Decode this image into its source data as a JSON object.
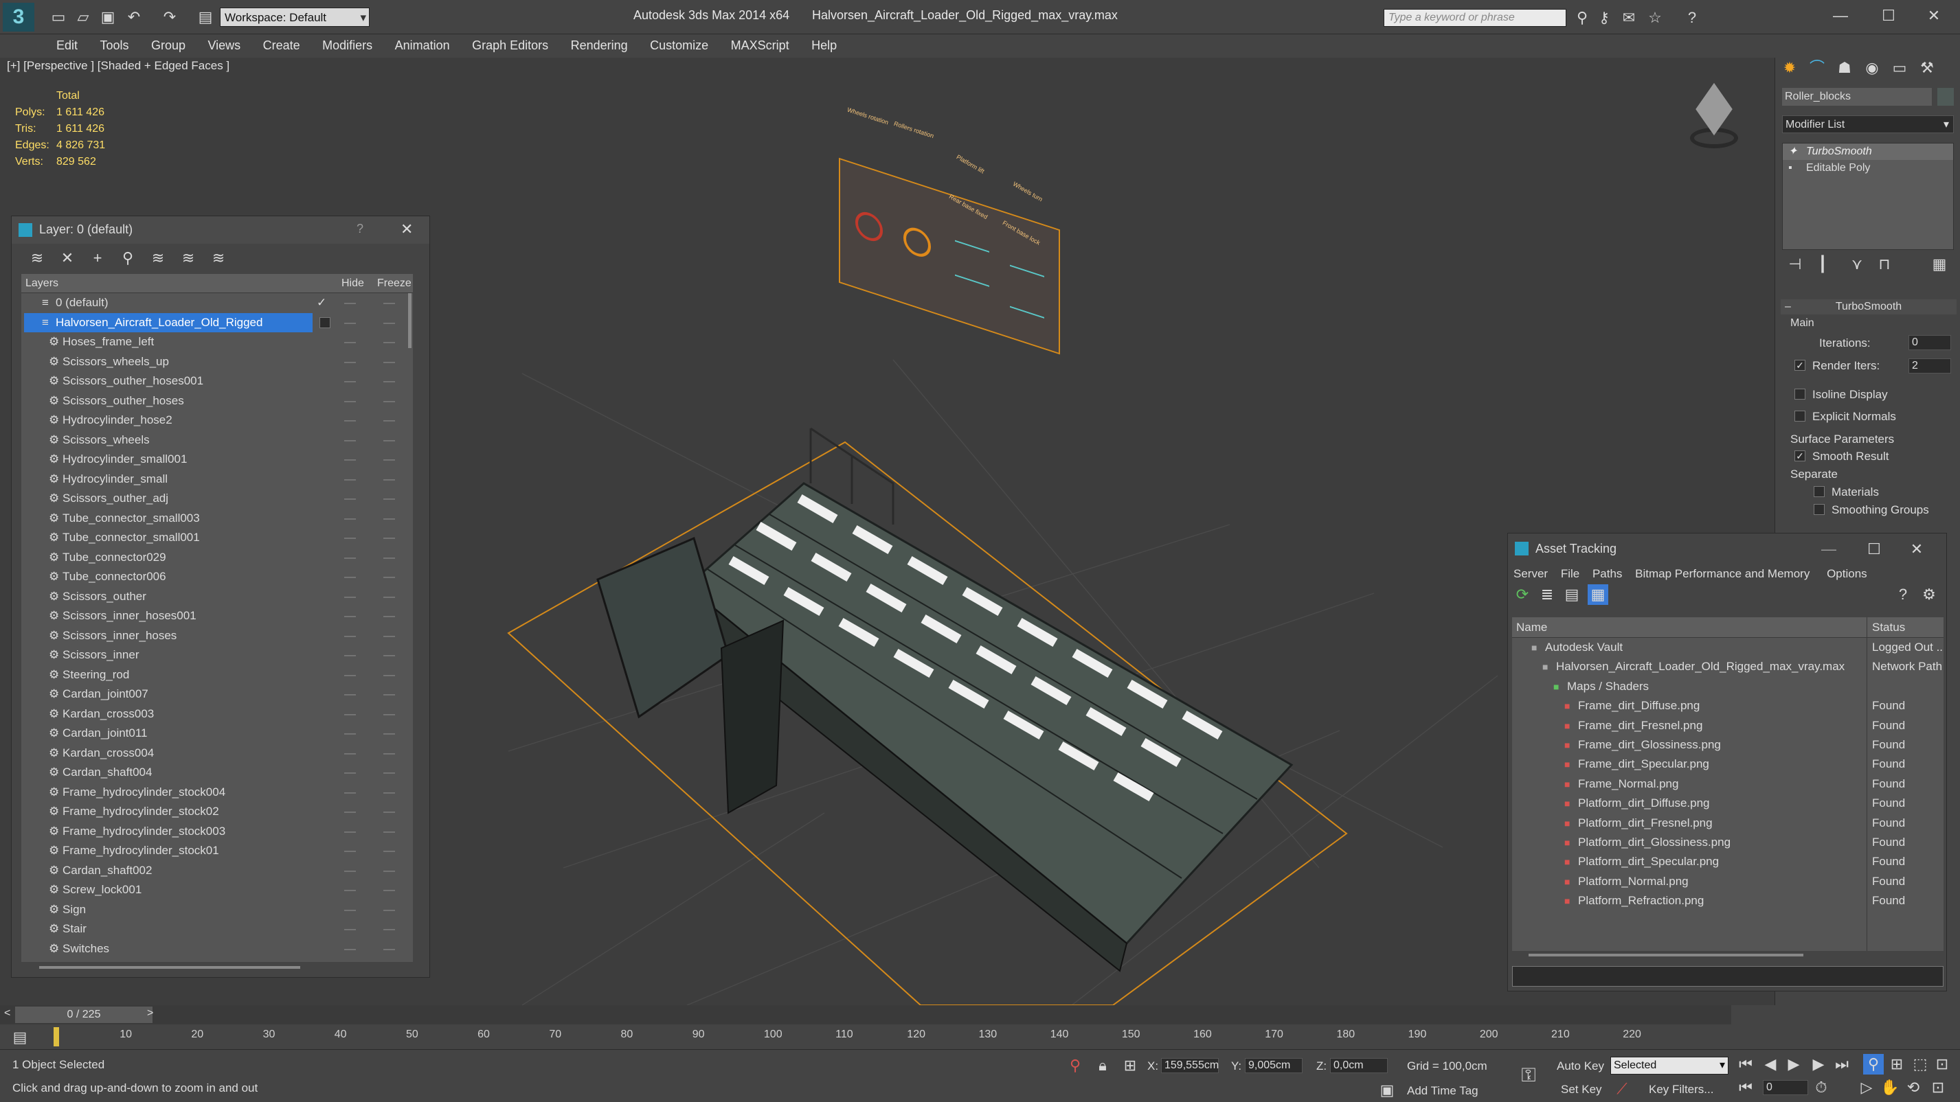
{
  "app": {
    "workspace": "Workspace: Default",
    "title": "Autodesk 3ds Max  2014 x64",
    "filename": "Halvorsen_Aircraft_Loader_Old_Rigged_max_vray.max",
    "search_placeholder": "Type a keyword or phrase"
  },
  "menu": [
    "Edit",
    "Tools",
    "Group",
    "Views",
    "Create",
    "Modifiers",
    "Animation",
    "Graph Editors",
    "Rendering",
    "Customize",
    "MAXScript",
    "Help"
  ],
  "viewport": {
    "label": "[+] [Perspective ] [Shaded + Edged Faces ]",
    "stats_header": "Total",
    "stats": [
      {
        "k": "Polys:",
        "v": "1 611 426"
      },
      {
        "k": "Tris:",
        "v": "1 611 426"
      },
      {
        "k": "Edges:",
        "v": "4 826 731"
      },
      {
        "k": "Verts:",
        "v": "829 562"
      }
    ],
    "panel_labels": [
      "Wheels rotation",
      "Rollers rotation",
      "Platform lift",
      "Wheels turn",
      "Rear base fixed",
      "Front base lock"
    ]
  },
  "layer_dialog": {
    "title": "Layer: 0 (default)",
    "help": "?",
    "col_layers": "Layers",
    "col_hide": "Hide",
    "col_freeze": "Freeze",
    "default_layer": "0 (default)",
    "selected_layer": "Halvorsen_Aircraft_Loader_Old_Rigged",
    "items": [
      "Hoses_frame_left",
      "Scissors_wheels_up",
      "Scissors_outher_hoses001",
      "Scissors_outher_hoses",
      "Hydrocylinder_hose2",
      "Scissors_wheels",
      "Hydrocylinder_small001",
      "Hydrocylinder_small",
      "Scissors_outher_adj",
      "Tube_connector_small003",
      "Tube_connector_small001",
      "Tube_connector029",
      "Tube_connector006",
      "Scissors_outher",
      "Scissors_inner_hoses001",
      "Scissors_inner_hoses",
      "Scissors_inner",
      "Steering_rod",
      "Cardan_joint007",
      "Kardan_cross003",
      "Cardan_joint011",
      "Kardan_cross004",
      "Cardan_shaft004",
      "Frame_hydrocylinder_stock004",
      "Frame_hydrocylinder_stock02",
      "Frame_hydrocylinder_stock003",
      "Frame_hydrocylinder_stock01",
      "Cardan_shaft002",
      "Screw_lock001",
      "Sign",
      "Stair",
      "Switches"
    ]
  },
  "command_panel": {
    "object_name": "Roller_blocks",
    "modifier_list": "Modifier List",
    "stack": [
      "TurboSmooth",
      "Editable Poly"
    ],
    "rollout_title": "TurboSmooth",
    "main_label": "Main",
    "iterations_label": "Iterations:",
    "iterations_value": "0",
    "render_iters_label": "Render Iters:",
    "render_iters_value": "2",
    "isoline": "Isoline Display",
    "explicit_normals": "Explicit Normals",
    "surface_params": "Surface Parameters",
    "smooth_result": "Smooth Result",
    "separate": "Separate",
    "materials": "Materials",
    "smoothing_groups": "Smoothing Groups"
  },
  "asset_tracking": {
    "title": "Asset Tracking",
    "menu": [
      "Server",
      "File",
      "Paths",
      "Bitmap Performance and Memory",
      "Options"
    ],
    "col_name": "Name",
    "col_status": "Status",
    "rows": [
      {
        "name": "Autodesk Vault",
        "status": "Logged Out ...",
        "indent": 1
      },
      {
        "name": "Halvorsen_Aircraft_Loader_Old_Rigged_max_vray.max",
        "status": "Network Path",
        "indent": 2
      },
      {
        "name": "Maps / Shaders",
        "status": "",
        "indent": 3
      },
      {
        "name": "Frame_dirt_Diffuse.png",
        "status": "Found",
        "indent": 4
      },
      {
        "name": "Frame_dirt_Fresnel.png",
        "status": "Found",
        "indent": 4
      },
      {
        "name": "Frame_dirt_Glossiness.png",
        "status": "Found",
        "indent": 4
      },
      {
        "name": "Frame_dirt_Specular.png",
        "status": "Found",
        "indent": 4
      },
      {
        "name": "Frame_Normal.png",
        "status": "Found",
        "indent": 4
      },
      {
        "name": "Platform_dirt_Diffuse.png",
        "status": "Found",
        "indent": 4
      },
      {
        "name": "Platform_dirt_Fresnel.png",
        "status": "Found",
        "indent": 4
      },
      {
        "name": "Platform_dirt_Glossiness.png",
        "status": "Found",
        "indent": 4
      },
      {
        "name": "Platform_dirt_Specular.png",
        "status": "Found",
        "indent": 4
      },
      {
        "name": "Platform_Normal.png",
        "status": "Found",
        "indent": 4
      },
      {
        "name": "Platform_Refraction.png",
        "status": "Found",
        "indent": 4
      }
    ]
  },
  "timeline": {
    "frame_counter": "0 / 225",
    "ticks": [
      "10",
      "20",
      "30",
      "40",
      "50",
      "60",
      "70",
      "80",
      "90",
      "100",
      "110",
      "120",
      "130",
      "140",
      "150",
      "160",
      "170",
      "180",
      "190",
      "200",
      "210",
      "220"
    ]
  },
  "status": {
    "selection": "1 Object Selected",
    "prompt": "Click and drag up-and-down to zoom in and out",
    "x_label": "X:",
    "x_value": "159,555cm",
    "y_label": "Y:",
    "y_value": "9,005cm",
    "z_label": "Z:",
    "z_value": "0,0cm",
    "grid": "Grid = 100,0cm",
    "add_time_tag": "Add Time Tag",
    "auto_key": "Auto Key",
    "set_key": "Set Key",
    "selected": "Selected",
    "key_filters": "Key Filters...",
    "frame": "0"
  }
}
